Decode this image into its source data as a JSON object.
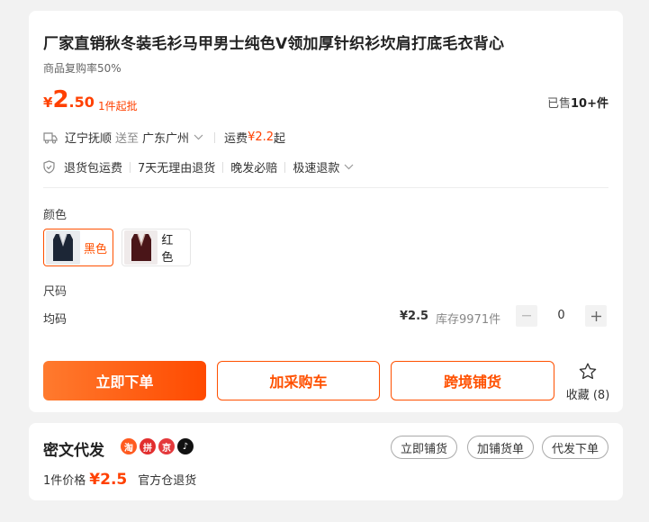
{
  "product": {
    "title": "厂家直销秋冬装毛衫马甲男士纯色V领加厚针织衫坎肩打底毛衣背心",
    "repurchase": "商品复购率50%",
    "price": {
      "currency": "¥",
      "integer": "2",
      "decimal": ".50"
    },
    "min_order": "1件起批",
    "sold_prefix": "已售",
    "sold_count": "10+件"
  },
  "shipping": {
    "from": "辽宁抚顺",
    "to_word": "送至",
    "to": "广东广州",
    "fee_label": "运费",
    "fee": "¥2.2",
    "fee_suffix": "起"
  },
  "services": [
    "退货包运费",
    "7天无理由退货",
    "晚发必赔",
    "极速退款"
  ],
  "sku": {
    "color_label": "颜色",
    "colors": [
      {
        "name": "黑色",
        "selected": true
      },
      {
        "name": "红色",
        "selected": false
      }
    ],
    "size_label": "尺码",
    "size_row": {
      "name": "均码",
      "price": "¥2.5",
      "stock": "库存9971件",
      "quantity": "0"
    }
  },
  "actions": {
    "buy_now": "立即下单",
    "add_cart": "加采购车",
    "cross_border": "跨境铺货",
    "favorite": "收藏 (8)"
  },
  "daifa": {
    "title": "密文代发",
    "platform_icons": [
      "taobao-icon",
      "pinduoduo-icon",
      "jd-icon",
      "tiktok-icon"
    ],
    "buttons": [
      "立即铺货",
      "加铺货单",
      "代发下单"
    ],
    "price_label": "1件价格",
    "price": "¥2.5",
    "return_note": "官方仓退货"
  },
  "colors": {
    "accent": "#ff5000",
    "price": "#ff4000"
  }
}
